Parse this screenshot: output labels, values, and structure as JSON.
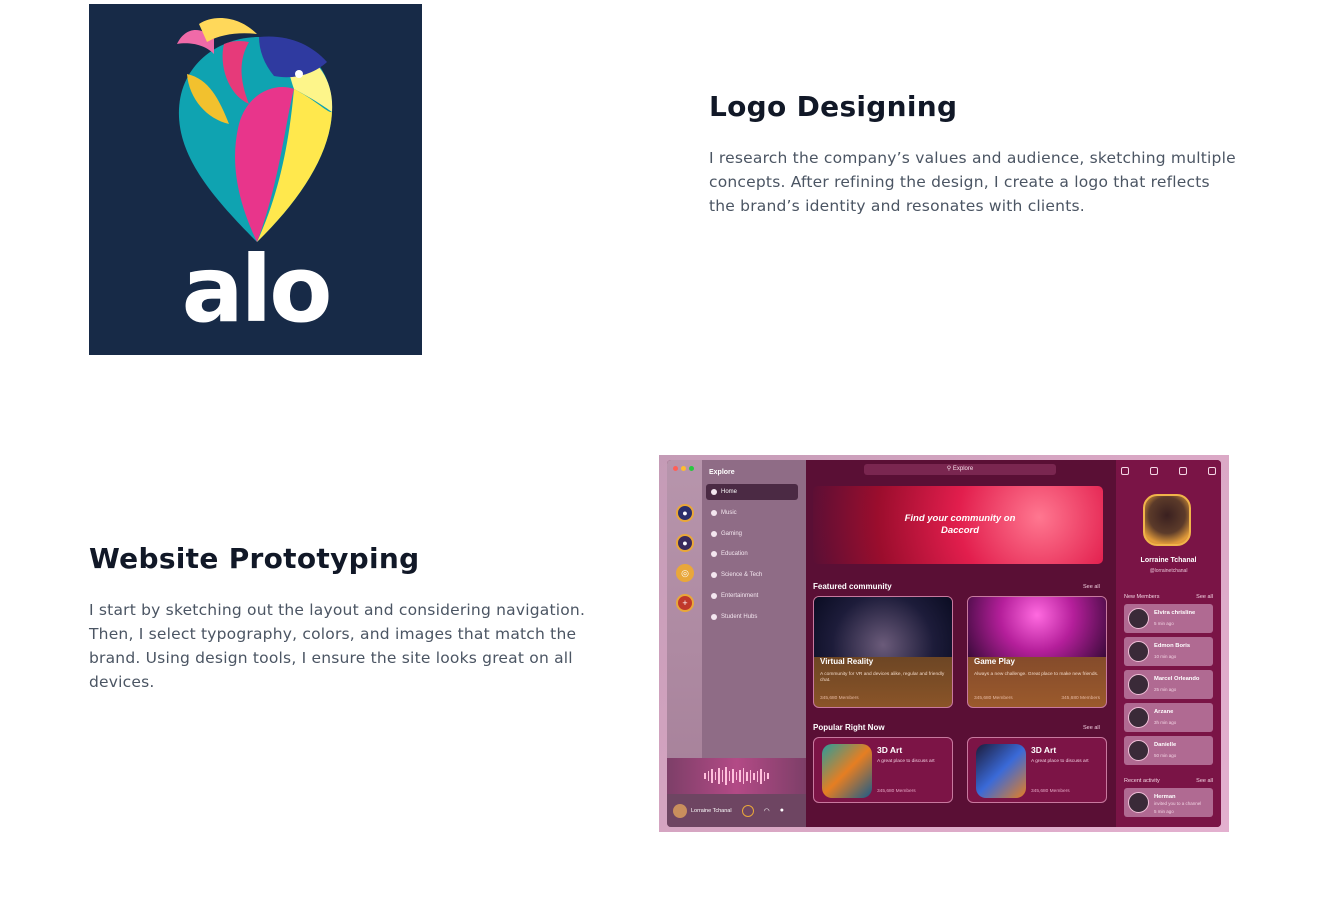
{
  "logo_section": {
    "logo_text": "alo",
    "title": "Logo Designing",
    "body": "I research the company’s values and audience, sketching multiple concepts. After refining the design, I create a logo that reflects the brand’s identity and resonates with clients."
  },
  "web_section": {
    "title": "Website Prototyping",
    "body": "I start by sketching out the layout and considering navigation. Then, I select typography, colors, and images that match the brand. Using design tools, I ensure the site looks great on all devices."
  },
  "mockup": {
    "sidebar": {
      "heading": "Explore",
      "items": [
        "Home",
        "Music",
        "Gaming",
        "Education",
        "Science & Tech",
        "Entertainment",
        "Student Hubs"
      ]
    },
    "search_placeholder": "Explore",
    "hero": "Find your community on Daccord",
    "featured": {
      "heading": "Featured community",
      "see_all": "See all",
      "cards": [
        {
          "title": "Virtual Reality",
          "desc": "A community for VR and devices alike, regular and friendly chat.",
          "members": "345,680 Members"
        },
        {
          "title": "Game Play",
          "desc": "Always a new challenge. Great place to make new friends.",
          "members": "345,680 Members",
          "members2": "345,680 Members"
        }
      ]
    },
    "popular": {
      "heading": "Popular Right Now",
      "see_all": "See all",
      "cards": [
        {
          "title": "3D Art",
          "desc": "A great place to discuss art",
          "members": "345,680 Members"
        },
        {
          "title": "3D Art",
          "desc": "A great place to discuss art",
          "members": "345,680 Members"
        }
      ]
    },
    "user_bar_name": "Lorraine Tchanal",
    "profile": {
      "name": "Lorraine Tchanal",
      "handle": "@lorrainetchanal",
      "new_members_heading": "New Members",
      "see_all": "See all",
      "members": [
        {
          "name": "Elvira chrisline",
          "time": "5 min ago"
        },
        {
          "name": "Edmon Boris",
          "time": "10 min ago"
        },
        {
          "name": "Marcel Orleando",
          "time": "25 min ago"
        },
        {
          "name": "Arzane",
          "time": "3h min ago"
        },
        {
          "name": "Danielle",
          "time": "50 min ago"
        }
      ],
      "recent_heading": "Recent activity",
      "recent": [
        {
          "name": "Herman",
          "text": "invited you to a channel",
          "time": "5 min ago"
        }
      ]
    }
  }
}
